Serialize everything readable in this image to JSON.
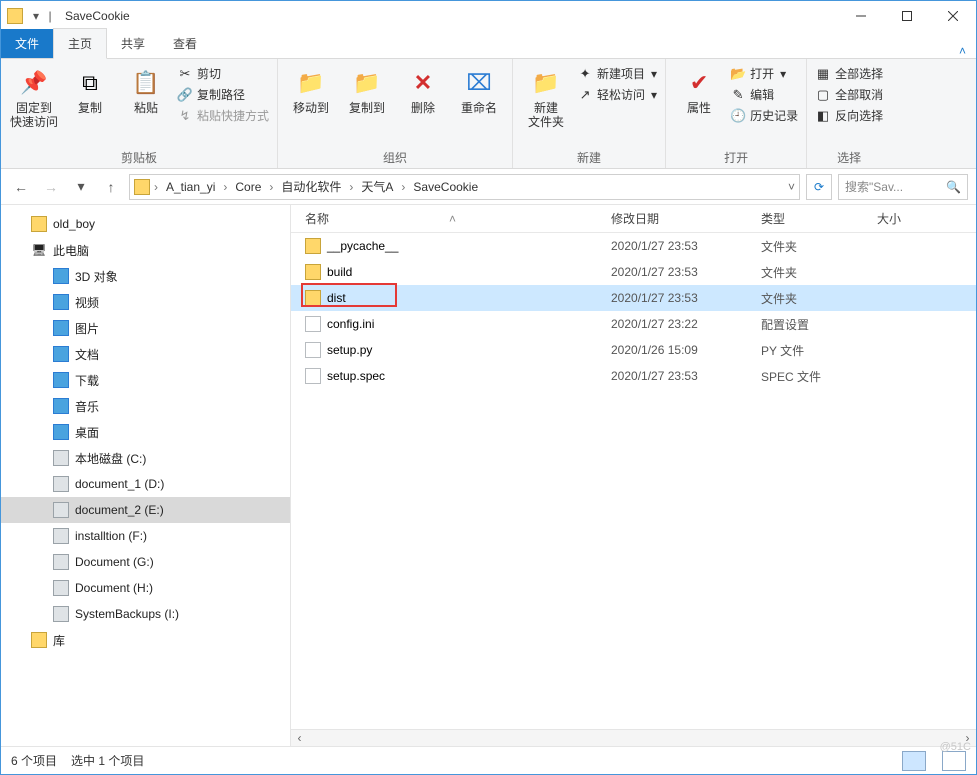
{
  "title": "SaveCookie",
  "tabs": {
    "file": "文件",
    "home": "主页",
    "share": "共享",
    "view": "查看"
  },
  "ribbon": {
    "clipboard": {
      "label": "剪贴板",
      "pin": "固定到\n快速访问",
      "copy": "复制",
      "paste": "粘贴",
      "cut": "剪切",
      "copypath": "复制路径",
      "pasteshort": "粘贴快捷方式"
    },
    "organize": {
      "label": "组织",
      "moveto": "移动到",
      "copyto": "复制到",
      "delete": "删除",
      "rename": "重命名"
    },
    "new": {
      "label": "新建",
      "newfolder": "新建\n文件夹",
      "newitem": "新建项目",
      "easyaccess": "轻松访问"
    },
    "open": {
      "label": "打开",
      "properties": "属性",
      "open": "打开",
      "edit": "编辑",
      "history": "历史记录"
    },
    "select": {
      "label": "选择",
      "all": "全部选择",
      "none": "全部取消",
      "invert": "反向选择"
    }
  },
  "breadcrumbs": [
    "A_tian_yi",
    "Core",
    "自动化软件",
    "天气A",
    "SaveCookie"
  ],
  "search_placeholder": "搜索\"Sav...",
  "columns": {
    "name": "名称",
    "date": "修改日期",
    "type": "类型",
    "size": "大小"
  },
  "files": [
    {
      "name": "__pycache__",
      "date": "2020/1/27 23:53",
      "type": "文件夹",
      "icon": "folder"
    },
    {
      "name": "build",
      "date": "2020/1/27 23:53",
      "type": "文件夹",
      "icon": "folder"
    },
    {
      "name": "dist",
      "date": "2020/1/27 23:53",
      "type": "文件夹",
      "icon": "folder",
      "selected": true
    },
    {
      "name": "config.ini",
      "date": "2020/1/27 23:22",
      "type": "配置设置",
      "icon": "file"
    },
    {
      "name": "setup.py",
      "date": "2020/1/26 15:09",
      "type": "PY 文件",
      "icon": "file"
    },
    {
      "name": "setup.spec",
      "date": "2020/1/27 23:53",
      "type": "SPEC 文件",
      "icon": "file"
    }
  ],
  "tree": [
    {
      "label": "old_boy",
      "icon": "folder"
    },
    {
      "label": "此电脑",
      "icon": "pc"
    },
    {
      "label": "3D 对象",
      "icon": "obj"
    },
    {
      "label": "视频",
      "icon": "obj"
    },
    {
      "label": "图片",
      "icon": "obj"
    },
    {
      "label": "文档",
      "icon": "obj"
    },
    {
      "label": "下载",
      "icon": "obj"
    },
    {
      "label": "音乐",
      "icon": "obj"
    },
    {
      "label": "桌面",
      "icon": "obj"
    },
    {
      "label": "本地磁盘 (C:)",
      "icon": "drive"
    },
    {
      "label": "document_1 (D:)",
      "icon": "drive"
    },
    {
      "label": "document_2 (E:)",
      "icon": "drive",
      "selected": true
    },
    {
      "label": "installtion (F:)",
      "icon": "drive"
    },
    {
      "label": "Document (G:)",
      "icon": "drive"
    },
    {
      "label": "Document (H:)",
      "icon": "drive"
    },
    {
      "label": "SystemBackups (I:)",
      "icon": "drive"
    },
    {
      "label": "库",
      "icon": "folder"
    }
  ],
  "status": {
    "count": "6 个项目",
    "selected": "选中 1 个项目"
  },
  "watermark": "@51C"
}
